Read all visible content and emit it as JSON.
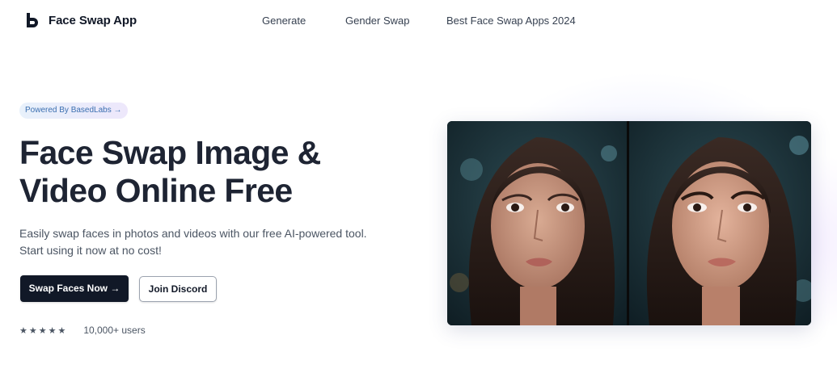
{
  "header": {
    "brand_name": "Face Swap App",
    "brand_icon": "basedlabs-logo-icon",
    "nav": [
      {
        "label": "Generate"
      },
      {
        "label": "Gender Swap"
      },
      {
        "label": "Best Face Swap Apps 2024"
      }
    ]
  },
  "hero": {
    "badge": "Powered By BasedLabs →",
    "headline_line1": "Face Swap Image &",
    "headline_line2": "Video Online Free",
    "subtext_line1": "Easily swap faces in photos and videos with our free AI-powered tool.",
    "subtext_line2": "Start using it now at no cost!",
    "primary_button": "Swap Faces Now →",
    "secondary_button": "Join Discord",
    "stars": "★★★★★",
    "rating_count": 5,
    "users_text": "10,000+ users"
  },
  "comparison": {
    "icon": "face-comparison-image",
    "accent_colors": {
      "hair": "#2a1d19",
      "skin_left": "#c9987f",
      "skin_right": "#d4a089",
      "background": "#173039",
      "lips": "#b0625a"
    }
  },
  "colors": {
    "text_dark": "#1e2433",
    "button_dark": "#111827",
    "badge_text": "#3b6fb0"
  }
}
